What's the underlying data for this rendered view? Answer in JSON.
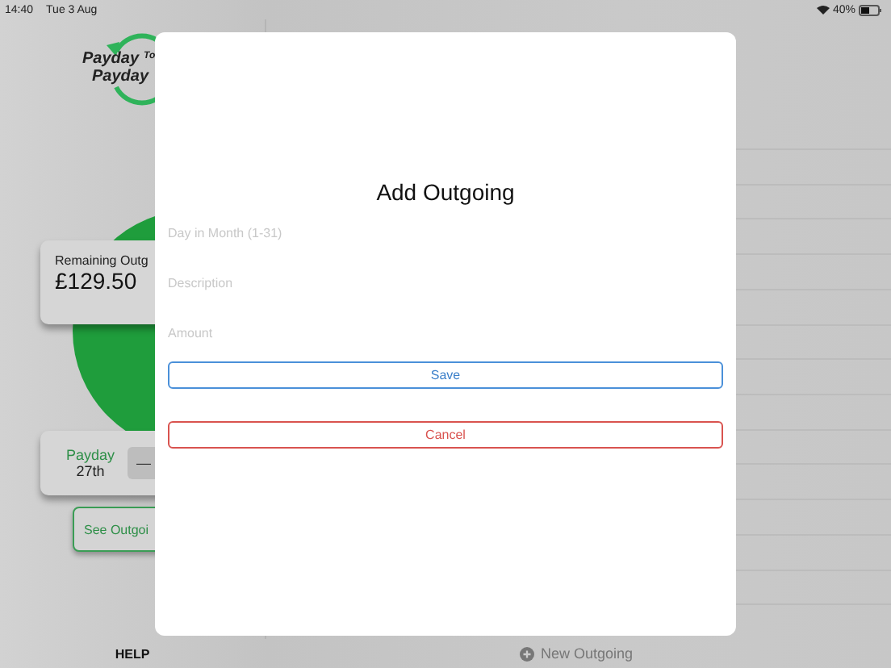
{
  "status_bar": {
    "time": "14:40",
    "date": "Tue 3 Aug",
    "battery": "40%"
  },
  "logo": {
    "line_1": "Payday",
    "connector": "To",
    "line_2": "Payday"
  },
  "remaining_card": {
    "label": "Remaining Outg",
    "amount": "£129.50"
  },
  "payday_card": {
    "label": "Payday",
    "day": "27th",
    "stepper_button": "—"
  },
  "see_outgoings_button": "See Outgoi",
  "dialog": {
    "title": "Add Outgoing",
    "fields": [
      {
        "placeholder": "Day in Month (1-31)"
      },
      {
        "placeholder": "Description"
      },
      {
        "placeholder": "Amount"
      }
    ],
    "buttons": [
      {
        "label": "Save",
        "kind": "primary"
      },
      {
        "label": "Cancel",
        "kind": "destructive"
      }
    ]
  },
  "bottom_bar": {
    "help": "HELP",
    "new_outgoing": "New Outgoing"
  }
}
